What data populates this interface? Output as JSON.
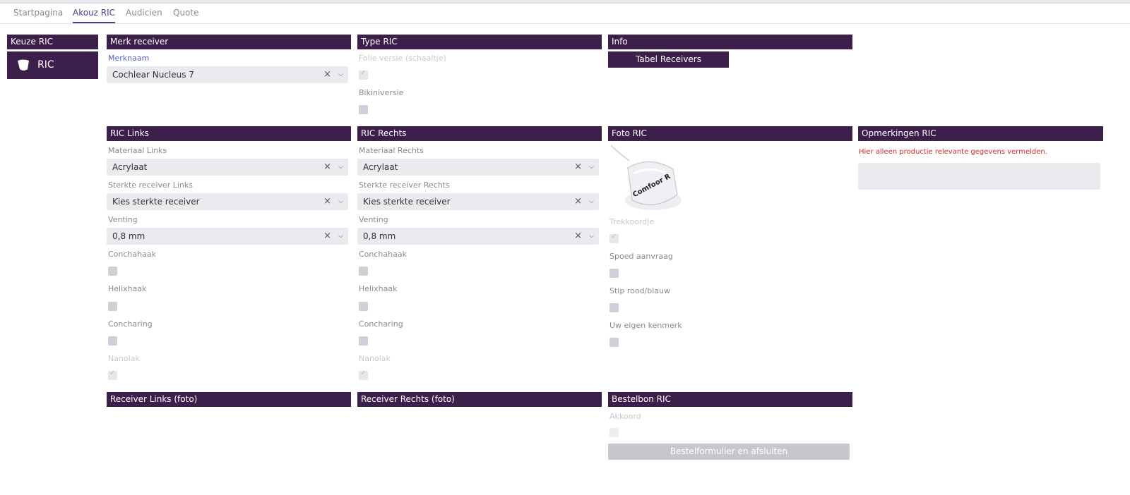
{
  "tabs": [
    "Startpagina",
    "Akouz RIC",
    "Audicien",
    "Quote"
  ],
  "keuze": {
    "header": "Keuze RIC",
    "tile_label": "RIC",
    "tile_icon": "earpiece-icon"
  },
  "merk": {
    "header": "Merk receiver",
    "label": "Merknaam",
    "value": "Cochlear Nucleus 7"
  },
  "type": {
    "header": "Type RIC",
    "folie_label": "Folie versie (schaaltje)",
    "folie_checked": true,
    "bikini_label": "Bikiniversie",
    "bikini_checked": false
  },
  "info": {
    "header": "Info",
    "button": "Tabel Receivers"
  },
  "links": {
    "header": "RIC Links",
    "materiaal_label": "Materiaal Links",
    "materiaal_value": "Acrylaat",
    "sterkte_label": "Sterkte receiver Links",
    "sterkte_value": "Kies sterkte receiver",
    "venting_label": "Venting",
    "venting_value": "0,8 mm",
    "concha_label": "Conchahaak",
    "helix_label": "Helixhaak",
    "concharing_label": "Concharing",
    "nanolak_label": "Nanolak"
  },
  "rechts": {
    "header": "RIC Rechts",
    "materiaal_label": "Materiaal Rechts",
    "materiaal_value": "Acrylaat",
    "sterkte_label": "Sterkte receiver Rechts",
    "sterkte_value": "Kies sterkte receiver",
    "venting_label": "Venting",
    "venting_value": "0,8 mm",
    "concha_label": "Conchahaak",
    "helix_label": "Helixhaak",
    "concharing_label": "Concharing",
    "nanolak_label": "Nanolak"
  },
  "foto": {
    "header": "Foto RIC",
    "photo_text": "Comfoor R",
    "trek_label": "Trekkoordje",
    "spoed_label": "Spoed aanvraag",
    "stip_label": "Stip rood/blauw",
    "kenmerk_label": "Uw eigen kenmerk"
  },
  "opm": {
    "header": "Opmerkingen RIC",
    "warning": "Hier alleen productie relevante gegevens vermelden."
  },
  "bottom": {
    "links_header": "Receiver Links (foto)",
    "rechts_header": "Receiver Rechts (foto)"
  },
  "bestelbon": {
    "header": "Bestelbon RIC",
    "akkoord_label": "Akkoord",
    "button": "Bestelformulier en afsluiten"
  },
  "icons": {
    "clear": "×",
    "chevron": "⌵"
  },
  "colors": {
    "header_bg": "#3c1f4a",
    "active_tab": "#4a3f8f",
    "warning": "#d42a2a",
    "input_bg": "#e9ebef"
  }
}
